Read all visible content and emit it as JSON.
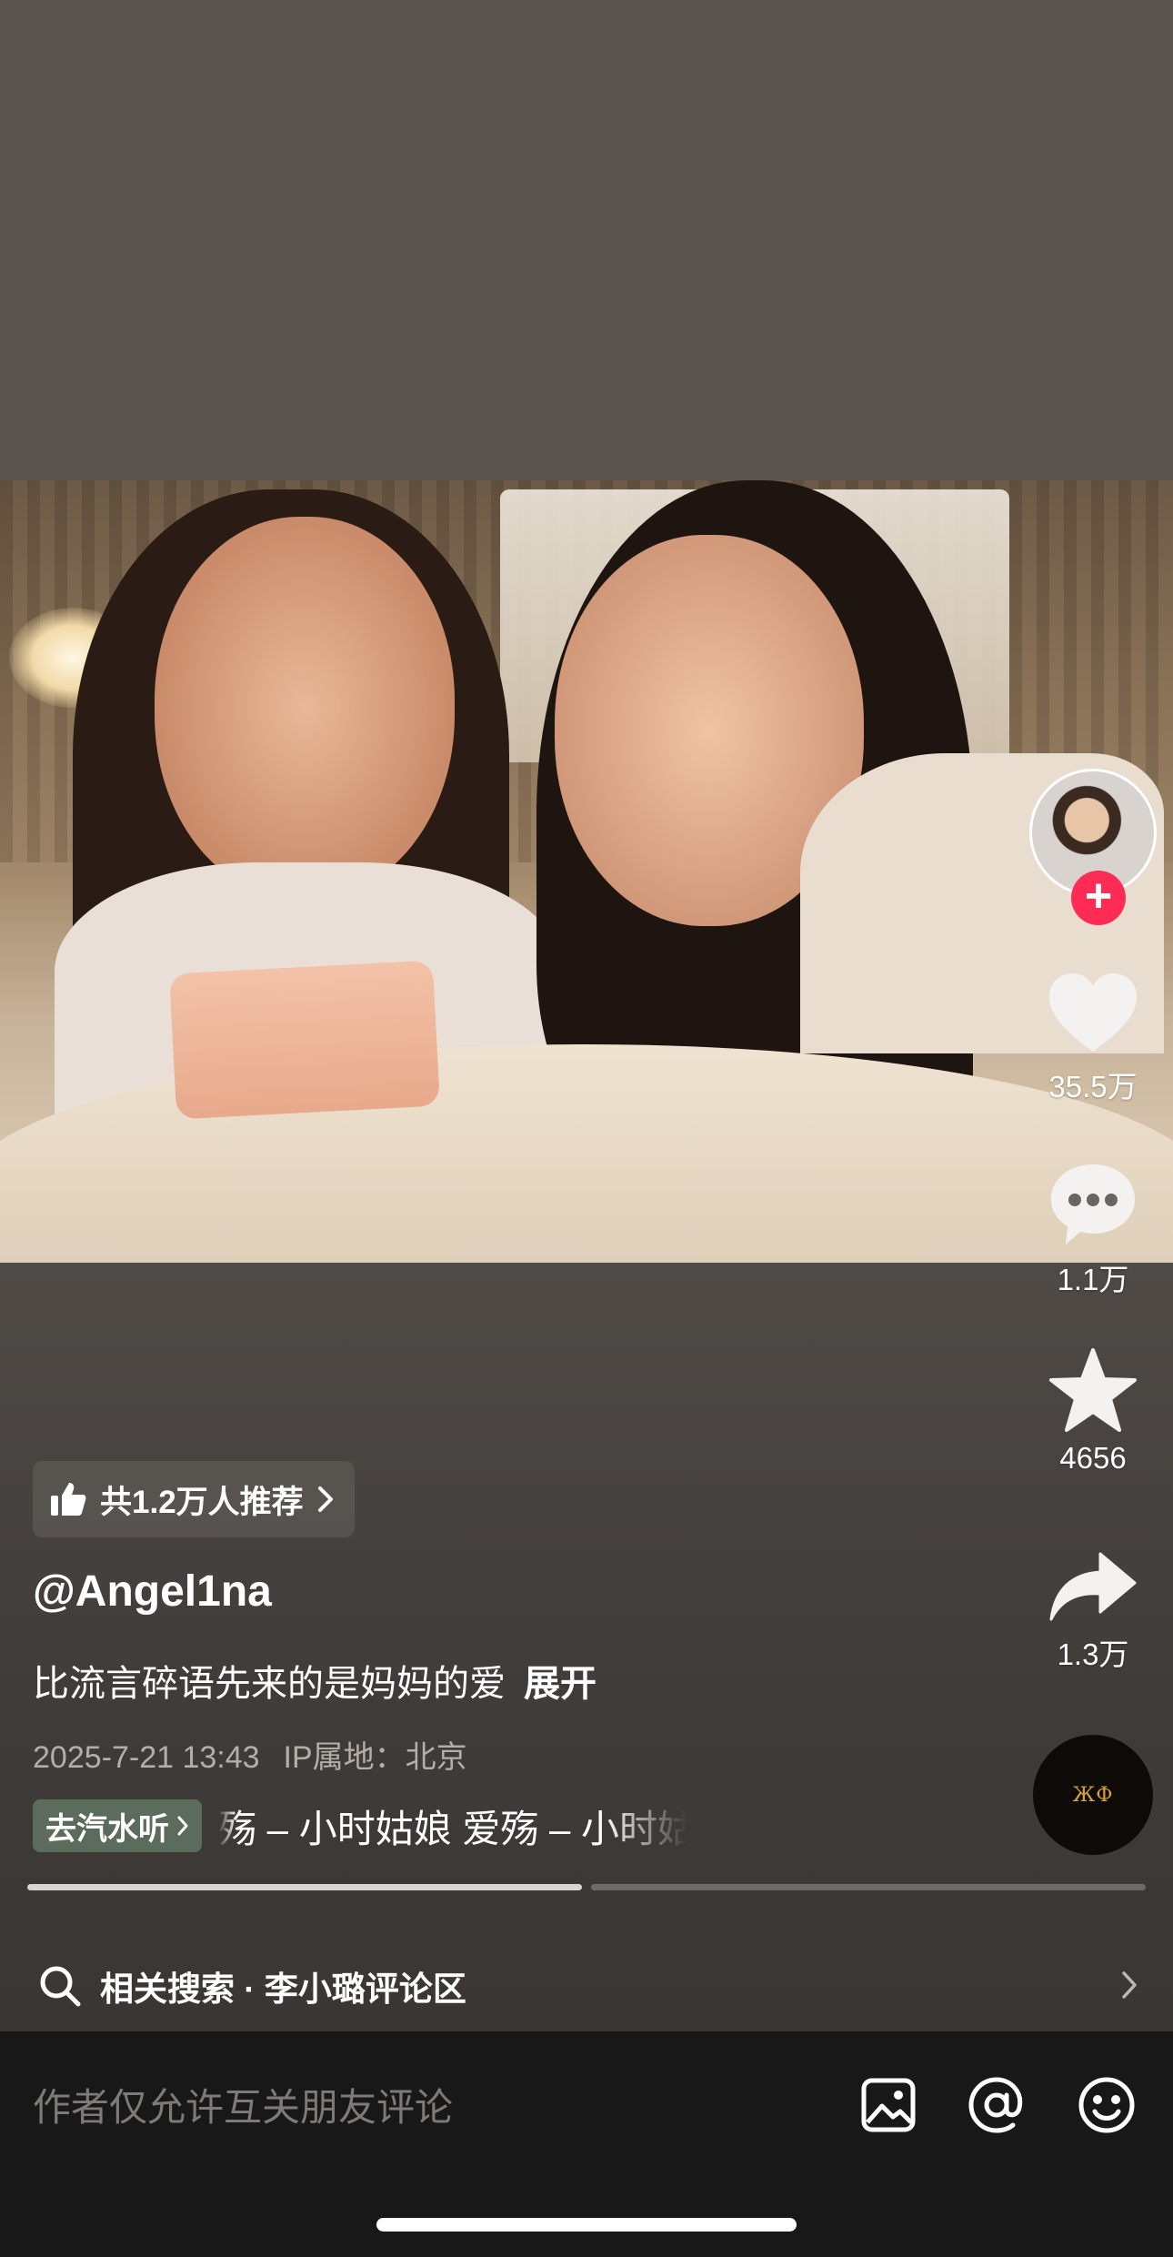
{
  "actions": {
    "like_count": "35.5万",
    "comment_count": "1.1万",
    "favorite_count": "4656",
    "share_count": "1.3万"
  },
  "follow_symbol": "+",
  "recommend": {
    "text": "共1.2万人推荐"
  },
  "post": {
    "author": "@Angel1na",
    "description": "比流言碎语先来的是妈妈的爱",
    "expand_label": "展开",
    "date": "2025-7-21 13:43",
    "ip_location": "IP属地：北京"
  },
  "music": {
    "qishui_label": "去汽水听",
    "marquee": "殇 – 小时姑娘    爱殇 – 小时姑娘",
    "disc_logo": "ЖФ"
  },
  "progress": {
    "current_segment_fill": 1.0,
    "segments": 2
  },
  "related_search": {
    "label": "相关搜索 · 李小璐评论区"
  },
  "comment_bar": {
    "placeholder": "作者仅允许互关朋友评论"
  },
  "colors": {
    "follow": "#fe2c55",
    "qishui_bg": "#5b6c5c",
    "comment_bar_bg": "#181818"
  },
  "icons": [
    "heart-icon",
    "comment-icon",
    "star-icon",
    "share-icon",
    "search-icon",
    "chevron-right-icon",
    "image-icon",
    "at-icon",
    "emoji-icon",
    "thumbs-up-icon"
  ]
}
